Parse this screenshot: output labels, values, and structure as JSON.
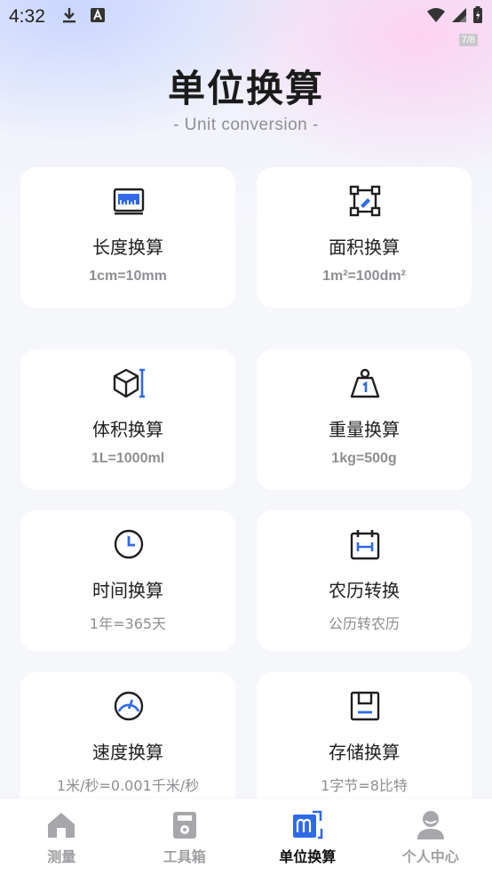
{
  "status_bar": {
    "time": "4:32",
    "fps": "7/8",
    "icons": [
      "download-icon",
      "a-letter-icon",
      "wifi-icon",
      "signal-icon",
      "battery-icon"
    ]
  },
  "header": {
    "title": "单位换算",
    "subtitle": "- Unit conversion -"
  },
  "accent_color": "#2f6ae8",
  "cards": [
    {
      "icon": "ruler-icon",
      "title": "长度换算",
      "subtitle": "1cm=10mm"
    },
    {
      "icon": "area-icon",
      "title": "面积换算",
      "subtitle": "1m²=100dm²"
    },
    {
      "icon": "cube-icon",
      "title": "体积换算",
      "subtitle": "1L=1000ml"
    },
    {
      "icon": "weight-icon",
      "title": "重量换算",
      "subtitle": "1kg=500g"
    },
    {
      "icon": "clock-icon",
      "title": "时间换算",
      "subtitle": "1年=365天"
    },
    {
      "icon": "calendar-icon",
      "title": "农历转换",
      "subtitle": "公历转农历"
    },
    {
      "icon": "speedometer-icon",
      "title": "速度换算",
      "subtitle": "1米/秒=0.001千米/秒"
    },
    {
      "icon": "floppy-disk-icon",
      "title": "存储换算",
      "subtitle": "1字节=8比特"
    }
  ],
  "tabbar": {
    "tabs": [
      {
        "icon": "home-icon",
        "label": "测量",
        "active": false
      },
      {
        "icon": "toolbox-icon",
        "label": "工具箱",
        "active": false
      },
      {
        "icon": "unit-conversion-icon",
        "label": "单位换算",
        "active": true
      },
      {
        "icon": "user-icon",
        "label": "个人中心",
        "active": false
      }
    ]
  }
}
